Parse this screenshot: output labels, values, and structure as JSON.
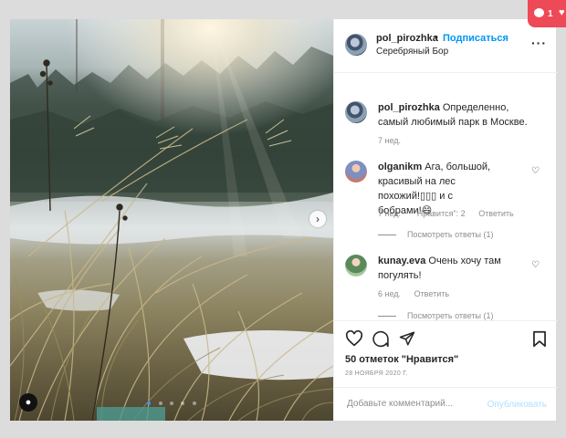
{
  "notification": {
    "count": "1",
    "extra_icon": "heart-icon"
  },
  "header": {
    "username": "pol_pirozhka",
    "separator": "•",
    "follow_label": "Подписаться",
    "location": "Серебряный Бор",
    "more_icon": "more-horizontal-icon"
  },
  "comments": [
    {
      "username": "pol_pirozhka",
      "text": "Определенно, самый любимый парк в Москве.",
      "time": "7 нед."
    },
    {
      "username": "olganikm",
      "text": "Ага, большой, красивый на лес похожий!▯▯▯ и с бобрами!😄",
      "time": "7 нед.",
      "likes": "\"Нравится\": 2",
      "reply": "Ответить",
      "view_replies": "Посмотреть ответы (1)"
    },
    {
      "username": "kunay.eva",
      "text": "Очень хочу там погулять!",
      "time": "6 нед.",
      "reply": "Ответить",
      "view_replies": "Посмотреть ответы (1)"
    }
  ],
  "actions": {
    "icons": [
      "heart-icon",
      "comment-icon",
      "share-icon",
      "bookmark-icon"
    ]
  },
  "likes_label": "50 отметок \"Нравится\"",
  "date": "28 НОЯБРЯ 2020 Г.",
  "add_comment": {
    "placeholder": "Добавьте комментарий...",
    "publish_label": "Опубликовать"
  },
  "colors": {
    "link": "#0095f6",
    "publish_disabled": "#b2dffc",
    "notification": "#ed4956"
  }
}
